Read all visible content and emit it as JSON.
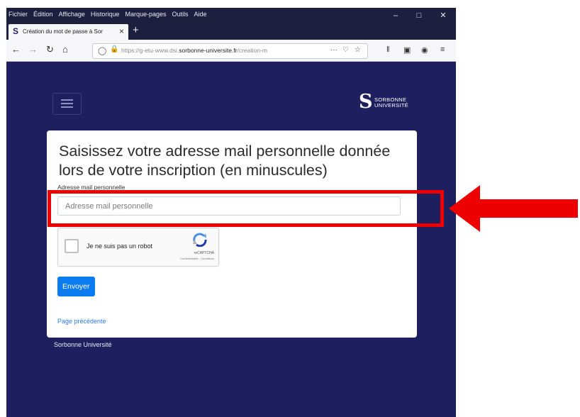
{
  "menu_bar": {
    "items": [
      "Fichier",
      "Édition",
      "Affichage",
      "Historique",
      "Marque-pages",
      "Outils",
      "Aide"
    ]
  },
  "tab": {
    "title": "Création du mot de passe à Sor"
  },
  "address_bar": {
    "url_prefix": "https://g-etu-www.dsi.",
    "url_domain": "sorbonne-universite.fr",
    "url_suffix": "/creation-m"
  },
  "header": {
    "logo_line1": "SORBONNE",
    "logo_line2": "UNIVERSITÉ"
  },
  "form": {
    "heading": "Saisissez votre adresse mail personnelle donnée lors de votre inscription (en minuscules)",
    "email_label": "Adresse mail personnelle",
    "email_placeholder": "Adresse mail personnelle",
    "email_value": "",
    "captcha_text": "Je ne suis pas un robot",
    "captcha_brand": "reCAPTCHA",
    "captcha_links": "Confidentialité - Conditions",
    "submit_label": "Envoyer",
    "back_link": "Page précédente"
  },
  "footer": {
    "text": "Sorbonne Université"
  },
  "colors": {
    "page_bg": "#1e1f5e",
    "button": "#0d7bf0",
    "annotation": "#ee0000"
  }
}
